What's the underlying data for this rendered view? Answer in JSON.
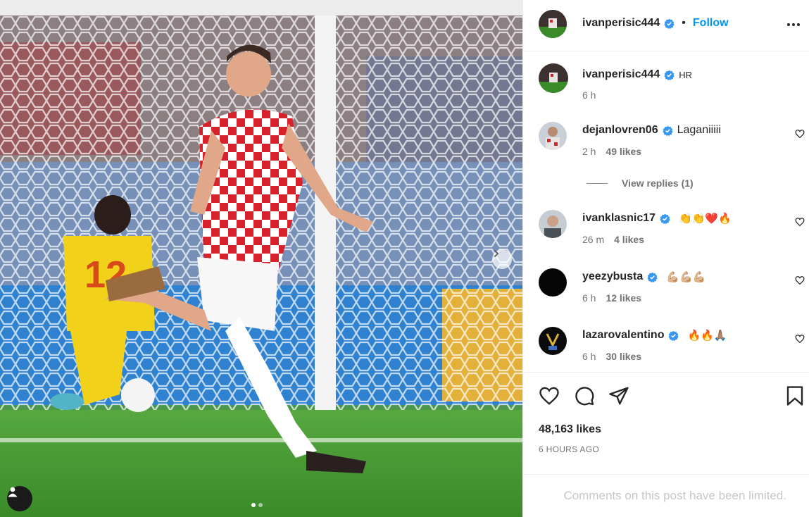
{
  "post": {
    "author": "ivanperisic444",
    "follow_label": "Follow",
    "separator": "•",
    "caption": {
      "username": "ivanperisic444",
      "text": "HR",
      "time": "6 h"
    },
    "likes": "48,163 likes",
    "time_ago": "6 HOURS AGO",
    "comments_limited": "Comments on this post have been limited."
  },
  "comments": [
    {
      "username": "dejanlovren06",
      "text": "Laganiiiii",
      "time": "2 h",
      "likes": "49 likes",
      "emoji": ""
    },
    {
      "username": "ivanklasnic17",
      "text": "",
      "time": "26 m",
      "likes": "4 likes",
      "emoji": "👏👏❤️🔥"
    },
    {
      "username": "yeezybusta",
      "text": "",
      "time": "6 h",
      "likes": "12 likes",
      "emoji": "💪🏼💪🏼💪🏼"
    },
    {
      "username": "lazarovalentino",
      "text": "",
      "time": "6 h",
      "likes": "30 likes",
      "emoji": "🔥🔥🙏🏽"
    }
  ],
  "view_replies": "View replies (1)",
  "carousel": {
    "current": 1,
    "total": 2
  },
  "colors": {
    "accent": "#0095f6",
    "verified": "#3897f0",
    "muted": "#737373",
    "jersey_red": "#d8222b"
  }
}
